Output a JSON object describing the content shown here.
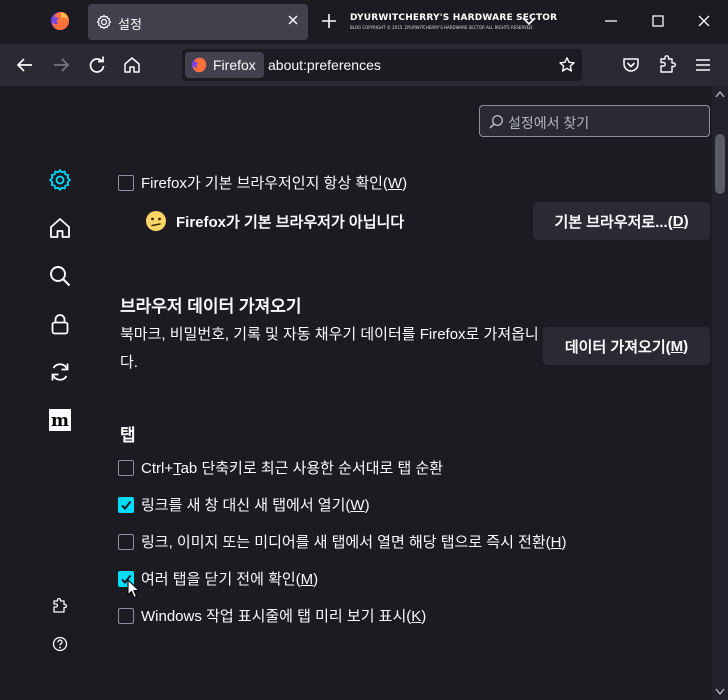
{
  "tab": {
    "title": "설정"
  },
  "banner": {
    "title": "DYURWITCHERRY'S HARDWARE SECTOR",
    "sub": "BLOG COPYRIGHT © 2015. DYURWITCHERRY'S HARDWARE SECTOR ALL RIGHTS RESERVED."
  },
  "urlbar": {
    "identity": "Firefox",
    "url": "about:preferences"
  },
  "search": {
    "placeholder": "설정에서 찾기"
  },
  "general": {
    "default_check": {
      "label": "Firefox가 기본 브라우저인지 항상 확인(",
      "key": "W",
      "end": ")",
      "checked": false
    },
    "not_default": "Firefox가 기본 브라우저가 아닙니다",
    "make_default_button": {
      "label": "기본 브라우저로...(",
      "key": "D",
      "end": ")"
    }
  },
  "import": {
    "heading": "브라우저 데이터 가져오기",
    "description": "북마크, 비밀번호, 기록 및 자동 채우기 데이터를 Firefox로 가져옵니다.",
    "button": {
      "label": "데이터 가져오기(",
      "key": "M",
      "end": ")"
    }
  },
  "tabs": {
    "heading": "탭",
    "options": [
      {
        "label": "Ctrl+",
        "key": "T",
        "rest": "ab 단축키로 최근 사용한 순서대로 탭 순환",
        "end": "",
        "checked": false
      },
      {
        "label": "링크를 새 창 대신 새 탭에서 열기(",
        "key": "W",
        "rest": "",
        "end": ")",
        "checked": true
      },
      {
        "label": "링크, 이미지 또는 미디어를 새 탭에서 열면 해당 탭으로 즉시 전환(",
        "key": "H",
        "rest": "",
        "end": ")",
        "checked": false
      },
      {
        "label": "여러 탭을 닫기 전에 확인(",
        "key": "M",
        "rest": "",
        "end": ")",
        "checked": true
      },
      {
        "label": "Windows 작업 표시줄에 탭 미리 보기 표시(",
        "key": "K",
        "rest": "",
        "end": ")",
        "checked": false
      }
    ]
  },
  "colors": {
    "accent": "#00ddff",
    "background": "#1c1b22",
    "toolbar": "#2b2a33",
    "button": "#2b2a33"
  }
}
